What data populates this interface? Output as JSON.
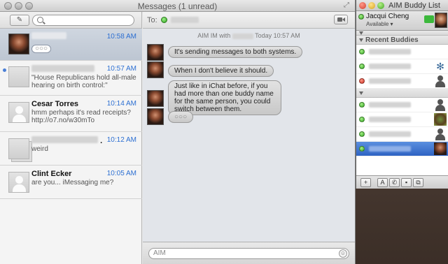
{
  "messages_window": {
    "title": "Messages (1 unread)",
    "to_label": "To:",
    "conversations": [
      {
        "name": "",
        "time": "10:58 AM",
        "snippet": "",
        "typing": "○○○",
        "selected": true
      },
      {
        "name": "",
        "time": "10:57 AM",
        "snippet": "\"House Republicans hold all-male hearing on birth control:\"",
        "unread": true
      },
      {
        "name": "Cesar Torres",
        "time": "10:14 AM",
        "snippet": "hmm perhaps it's read receipts? http://o7.no/w30mTo"
      },
      {
        "name": "",
        "time": "10:12 AM",
        "snippet": "weird",
        "name_suffix": "."
      },
      {
        "name": "Clint Ecker",
        "time": "10:05 AM",
        "snippet": "are you... iMessaging me?"
      }
    ],
    "thread": {
      "stamp_prefix": "AIM IM with",
      "stamp_suffix": "Today 10:57 AM",
      "bubbles": [
        "It's sending messages to both systems.",
        "When I don't believe it should.",
        "Just like in iChat before, if you had more than one buddy name for the same person, you could switch between them.",
        "○○○"
      ]
    },
    "compose_placeholder": "AIM",
    "emoji_glyph": "☺"
  },
  "buddy_list": {
    "title": "AIM Buddy List",
    "me_name": "Jacqui Cheng",
    "me_status": "Available ▾",
    "group_recent": "Recent Buddies",
    "buddies": [
      {
        "status": "green",
        "icon": "none"
      },
      {
        "status": "green",
        "icon": "dragonfly"
      },
      {
        "status": "red",
        "icon": "person"
      },
      {
        "status": "green",
        "icon": "person"
      },
      {
        "status": "green",
        "icon": "turtle"
      },
      {
        "status": "green",
        "icon": "person"
      },
      {
        "status": "green",
        "icon": "photo",
        "selected": true
      }
    ],
    "toolbar": {
      "add": "+",
      "font": "A",
      "phone": "✆",
      "video": "▪",
      "screen": "⧉"
    }
  }
}
